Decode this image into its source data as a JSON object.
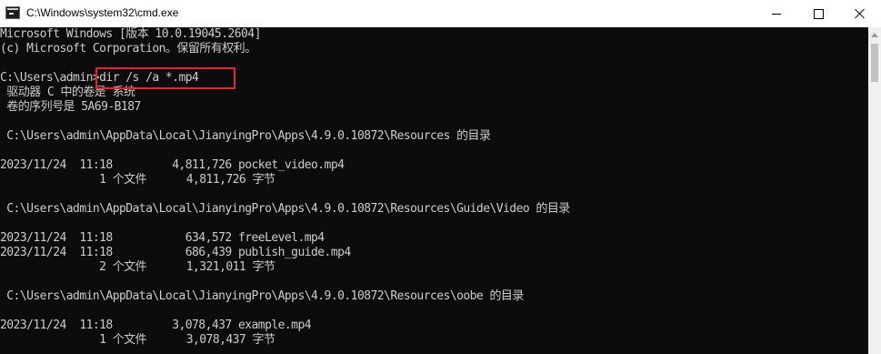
{
  "window": {
    "title": "C:\\Windows\\system32\\cmd.exe",
    "icon": "cmd-icon",
    "controls": {
      "minimize": "minimize-icon",
      "maximize": "maximize-icon",
      "close": "close-icon"
    }
  },
  "console": {
    "lines": [
      "Microsoft Windows [版本 10.0.19045.2604]",
      "(c) Microsoft Corporation。保留所有权利。",
      "",
      "C:\\Users\\admin>dir /s /a *.mp4",
      " 驱动器 C 中的卷是 系统",
      " 卷的序列号是 5A69-B187",
      "",
      " C:\\Users\\admin\\AppData\\Local\\JianyingPro\\Apps\\4.9.0.10872\\Resources 的目录",
      "",
      "2023/11/24  11:18         4,811,726 pocket_video.mp4",
      "               1 个文件      4,811,726 字节",
      "",
      " C:\\Users\\admin\\AppData\\Local\\JianyingPro\\Apps\\4.9.0.10872\\Resources\\Guide\\Video 的目录",
      "",
      "2023/11/24  11:18           634,572 freeLevel.mp4",
      "2023/11/24  11:18           686,439 publish_guide.mp4",
      "               2 个文件      1,321,011 字节",
      "",
      " C:\\Users\\admin\\AppData\\Local\\JianyingPro\\Apps\\4.9.0.10872\\Resources\\oobe 的目录",
      "",
      "2023/11/24  11:18         3,078,437 example.mp4",
      "               1 个文件      3,078,437 字节"
    ]
  },
  "colors": {
    "console_bg": "#0c0c0c",
    "console_text": "#cccccc",
    "highlight": "#e8232a",
    "titlebar_bg": "#ffffff"
  }
}
